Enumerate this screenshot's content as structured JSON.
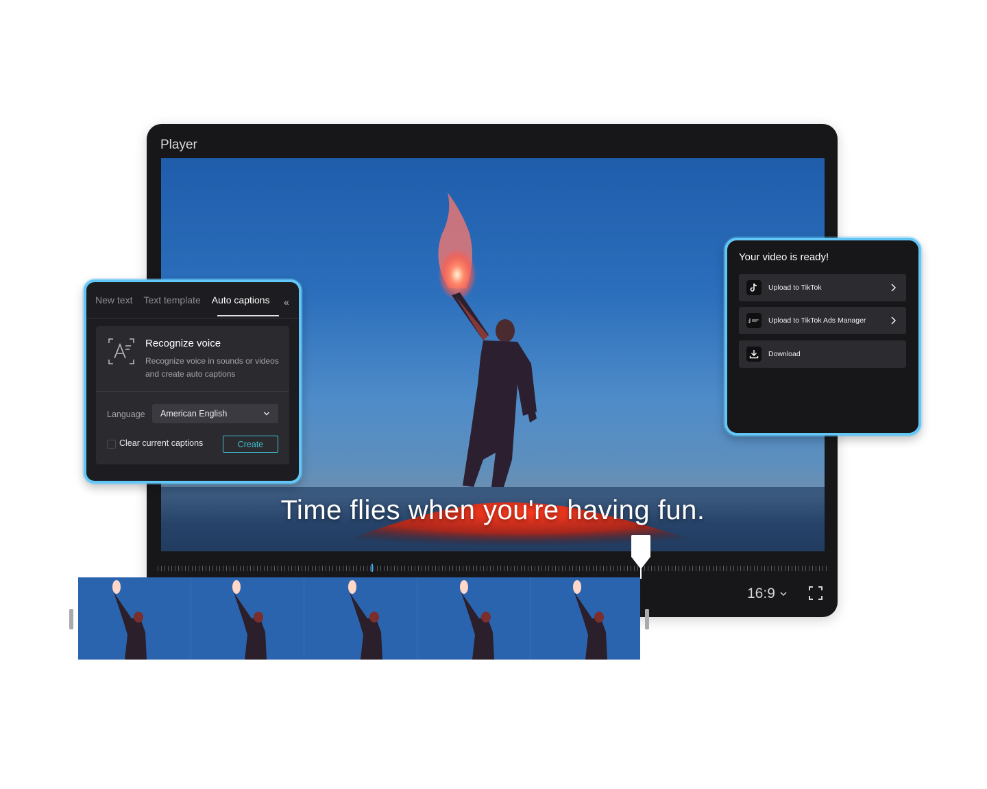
{
  "player": {
    "title": "Player",
    "caption": "Time flies when you're having fun.",
    "aspect_ratio": "16:9"
  },
  "text_panel": {
    "tabs": [
      "New text",
      "Text template",
      "Auto captions"
    ],
    "active_tab": "Auto captions",
    "card_title": "Recognize voice",
    "card_description": "Recognize voice in sounds or videos and create auto captions",
    "language_label": "Language",
    "language_value": "American English",
    "checkbox_label": "Clear current captions",
    "create_label": "Create"
  },
  "export_panel": {
    "title": "Your video is ready!",
    "items": [
      {
        "label": "Upload to TikTok",
        "icon": "tiktok-icon"
      },
      {
        "label": "Upload to TikTok Ads Manager",
        "icon": "tiktok-ads-icon"
      },
      {
        "label": "Download",
        "icon": "download-icon"
      }
    ]
  },
  "colors": {
    "accent_border": "#62c6f6",
    "create_button": "#3fc1d0",
    "panel_bg": "#1d1d21"
  }
}
